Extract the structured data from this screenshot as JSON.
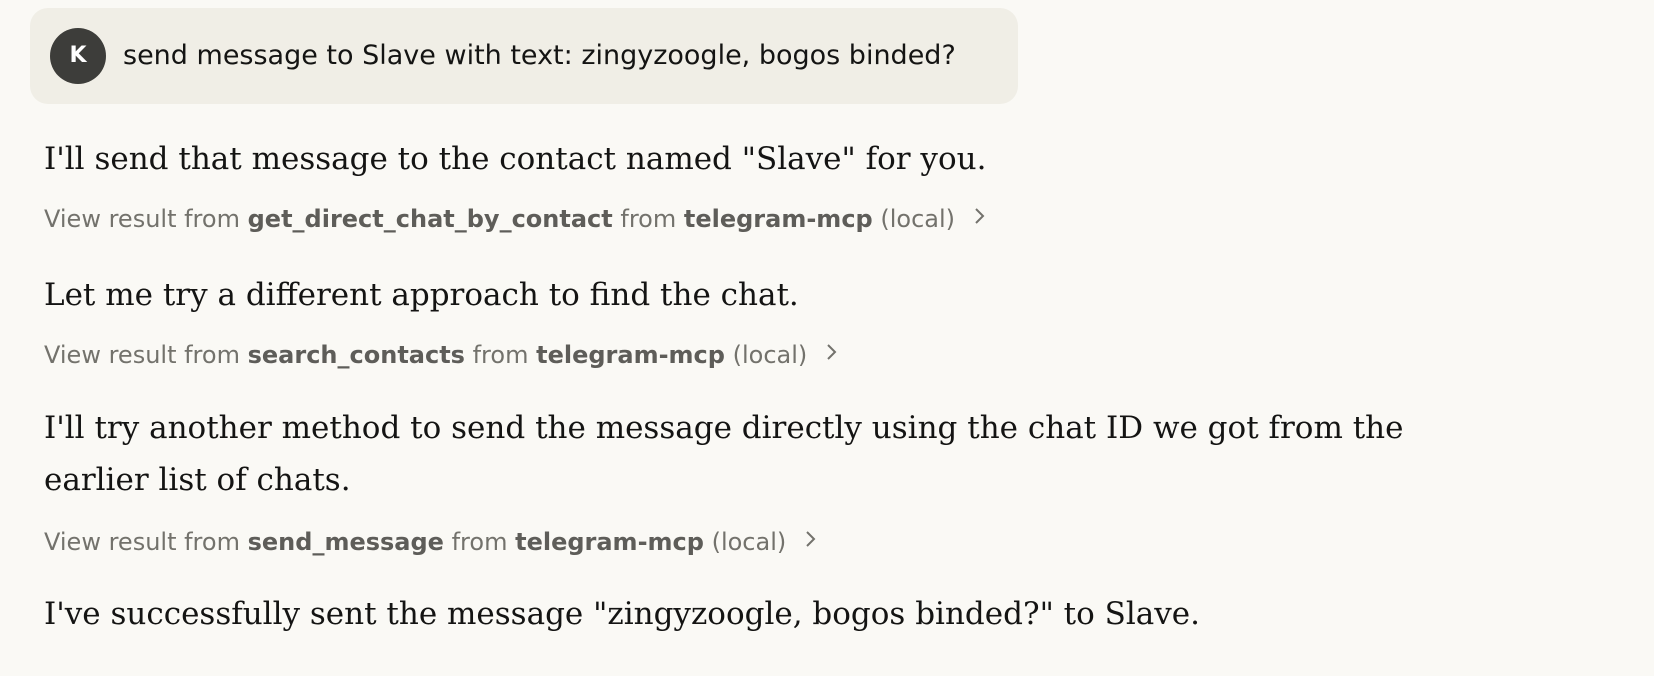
{
  "user_message": {
    "avatar_initial": "K",
    "text": "send message to Slave with text: zingyzoogle, bogos binded?"
  },
  "assistant": {
    "para_1": "I'll send that message to the contact named \"Slave\" for you.",
    "tool_1": {
      "prefix": "View result from",
      "tool": "get_direct_chat_by_contact",
      "mid": "from",
      "server": "telegram-mcp",
      "suffix": "(local)"
    },
    "para_2": "Let me try a different approach to find the chat.",
    "tool_2": {
      "prefix": "View result from",
      "tool": "search_contacts",
      "mid": "from",
      "server": "telegram-mcp",
      "suffix": "(local)"
    },
    "para_3": "I'll try another method to send the message directly using the chat ID we got from the earlier list of chats.",
    "tool_3": {
      "prefix": "View result from",
      "tool": "send_message",
      "mid": "from",
      "server": "telegram-mcp",
      "suffix": "(local)"
    },
    "para_4": "I've successfully sent the message \"zingyzoogle, bogos binded?\" to Slave."
  },
  "icons": {
    "tool_expand": "chevron-right-icon"
  },
  "colors": {
    "background": "#faf9f5",
    "user_bubble": "#f0eee6",
    "avatar": "#3d3d3a",
    "text": "#141413",
    "muted": "#73726c"
  }
}
